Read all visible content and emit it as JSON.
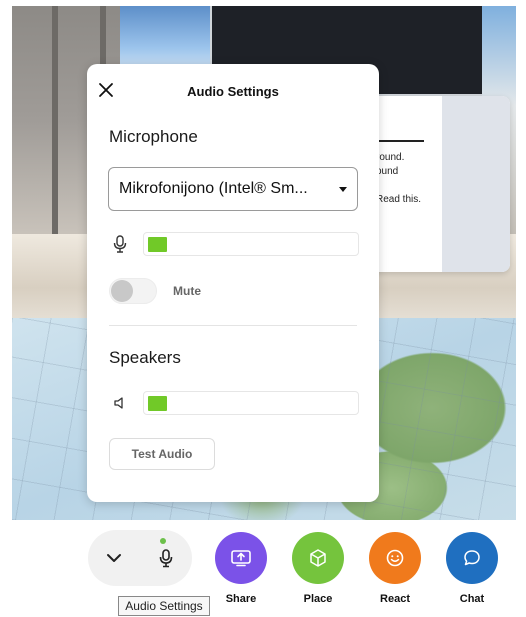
{
  "info_card": {
    "lines": [
      "round.",
      "ound",
      "Read this."
    ]
  },
  "audio_settings": {
    "title": "Audio Settings",
    "microphone": {
      "section_label": "Microphone",
      "selected_device": "Mikrofonijono (Intel® Sm...",
      "level_fraction": 0.09,
      "mute_label": "Mute",
      "muted": false
    },
    "speakers": {
      "section_label": "Speakers",
      "level_fraction": 0.09
    },
    "test_audio_label": "Test Audio"
  },
  "toolbar": {
    "tools": [
      {
        "id": "share",
        "label": "Share",
        "color": "#7b52e8"
      },
      {
        "id": "place",
        "label": "Place",
        "color": "#75c43d"
      },
      {
        "id": "react",
        "label": "React",
        "color": "#f07a1c"
      },
      {
        "id": "chat",
        "label": "Chat",
        "color": "#1f6fc0"
      }
    ],
    "tooltip": "Audio Settings"
  },
  "icons": {
    "close": "close-icon",
    "microphone": "microphone-icon",
    "speaker": "speaker-icon",
    "chevron": "chevron-down-icon",
    "share": "screen-share-icon",
    "place": "cube-icon",
    "react": "smiley-icon",
    "chat": "chat-bubble-icon"
  },
  "colors": {
    "meter": "#71c928",
    "mic_active": "#6cc04a"
  }
}
